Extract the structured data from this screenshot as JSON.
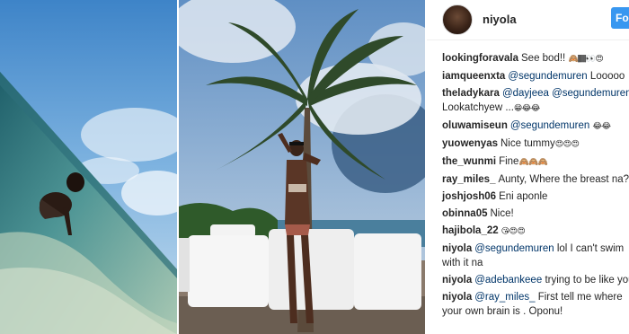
{
  "post": {
    "username": "niyola",
    "follow_label": "Fo"
  },
  "comments": [
    {
      "user": "lookingforavala",
      "pre": "",
      "mention": "",
      "text": "See bod!!",
      "emoji": "🙈🏾👀😍"
    },
    {
      "user": "iamqueenxta",
      "pre": "",
      "mention": "@segundemuren",
      "text": "Looooo",
      "emoji": ""
    },
    {
      "user": "theladykara",
      "pre": "",
      "mention": "@dayjeea @segundemuren",
      "text": "Lookatchyew ...",
      "emoji": "😁😂😂"
    },
    {
      "user": "oluwamiseun",
      "pre": "",
      "mention": "@segundemuren",
      "text": "",
      "emoji": "😂😂"
    },
    {
      "user": "yuowenyas",
      "pre": "",
      "mention": "",
      "text": "Nice tummy",
      "emoji": "😍😍😍"
    },
    {
      "user": "the_wunmi",
      "pre": "",
      "mention": "",
      "text": "Fine",
      "emoji": "🙈🙈🙈"
    },
    {
      "user": "ray_miles_",
      "pre": "",
      "mention": "",
      "text": "Aunty, Where the breast na?..",
      "emoji": ""
    },
    {
      "user": "joshjosh06",
      "pre": "",
      "mention": "",
      "text": "Eni aponle",
      "emoji": ""
    },
    {
      "user": "obinna05",
      "pre": "",
      "mention": "",
      "text": "Nice!",
      "emoji": ""
    },
    {
      "user": "hajibola_22",
      "pre": "",
      "mention": "",
      "text": "",
      "emoji": "😘😍😍"
    },
    {
      "user": "niyola",
      "pre": "",
      "mention": "@segundemuren",
      "text": "lol I can't swim with it na",
      "emoji": ""
    },
    {
      "user": "niyola",
      "pre": "",
      "mention": "@adebankeee",
      "text": "trying to be like you",
      "emoji": ""
    },
    {
      "user": "niyola",
      "pre": "",
      "mention": "@ray_miles_",
      "text": "First tell me where your own brain is . Oponu!",
      "emoji": ""
    }
  ],
  "colors": {
    "follow": "#3897f0",
    "mention": "#003569",
    "text": "#262626"
  }
}
